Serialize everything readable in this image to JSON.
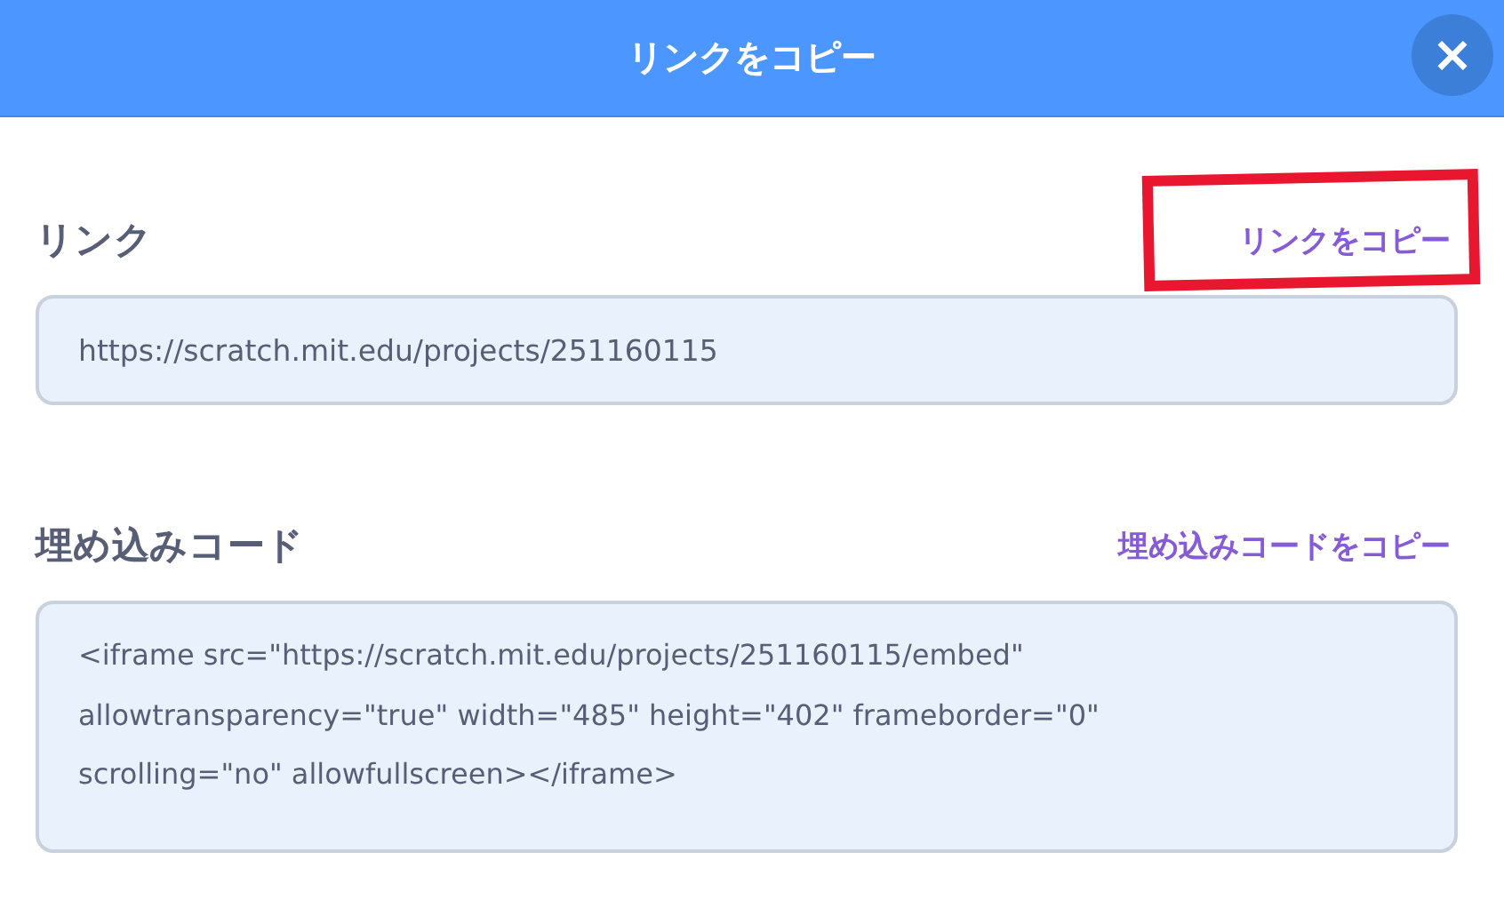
{
  "window": {
    "title": "リンクをコピー",
    "close_icon": "×"
  },
  "sections": [
    {
      "kind": "link",
      "label": "リンク",
      "action": "リンクをコピー",
      "highlighted": true,
      "value": "https://scratch.mit.edu/projects/251160115"
    },
    {
      "kind": "code",
      "label": "埋め込みコード",
      "action": "埋め込みコードをコピー",
      "highlighted": false,
      "value": "<iframe src=\"https://scratch.mit.edu/projects/251160115/embed\" allowtransparency=\"true\" width=\"485\" height=\"402\" frameborder=\"0\" scrolling=\"no\" allowfullscreen></iframe>"
    }
  ]
}
